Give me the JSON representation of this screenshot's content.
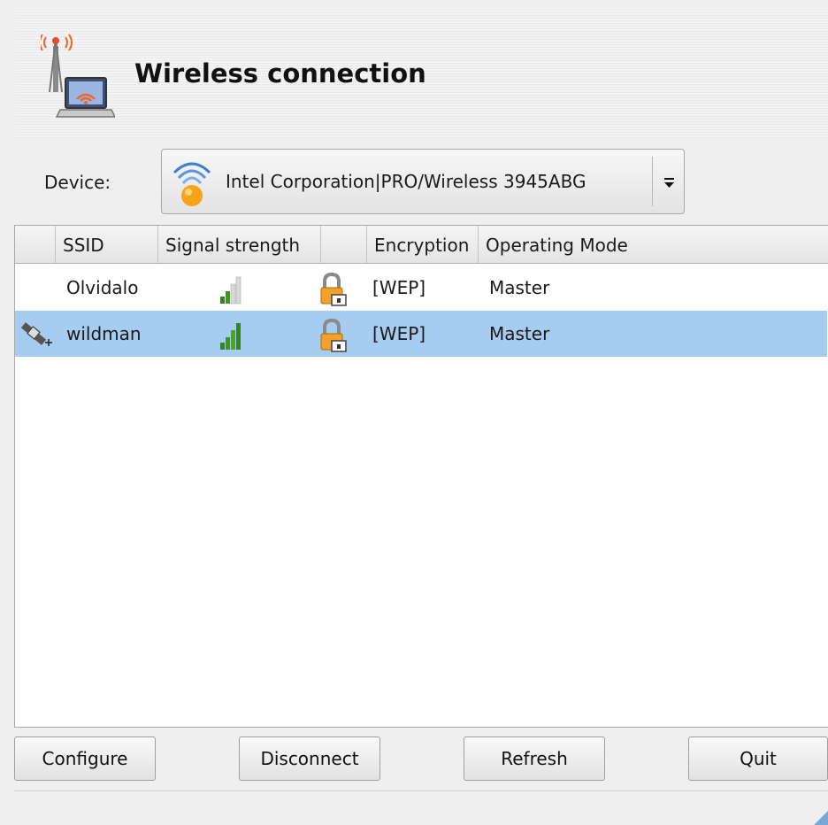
{
  "window": {
    "title": "Wireless connection",
    "accent_color": "#a6cdf0"
  },
  "device": {
    "label": "Device:",
    "selected": "Intel Corporation|PRO/Wireless 3945ABG",
    "icon": "wifi-signal-icon"
  },
  "table": {
    "columns": [
      "",
      "SSID",
      "Signal strength",
      "",
      "Encryption",
      "Operating Mode"
    ],
    "rows": [
      {
        "status_icon": "",
        "ssid": "Olvidalo",
        "signal": "medium",
        "lock_icon": "padlock-icon",
        "encryption": "[WEP]",
        "mode": "Master",
        "selected": false
      },
      {
        "status_icon": "satellite-connected-icon",
        "ssid": "wildman",
        "signal": "strong",
        "lock_icon": "padlock-icon",
        "encryption": "[WEP]",
        "mode": "Master",
        "selected": true
      }
    ]
  },
  "buttons": {
    "configure": "Configure",
    "disconnect": "Disconnect",
    "refresh": "Refresh",
    "quit": "Quit"
  }
}
